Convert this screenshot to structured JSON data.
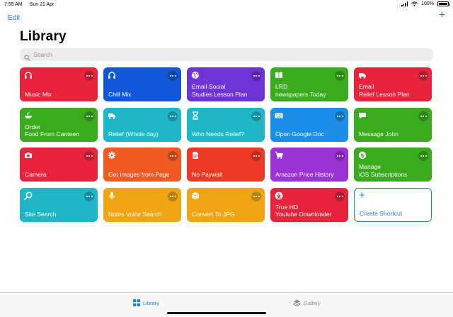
{
  "status": {
    "time": "7:55 AM",
    "date": "Sun 21 Apr",
    "battery": "100%",
    "battery_level": 1.0
  },
  "nav": {
    "edit_label": "Edit",
    "add_label": "+"
  },
  "title": "Library",
  "search": {
    "placeholder": "Search"
  },
  "shortcuts": [
    {
      "title": "Music Mix",
      "color": "#e8233c",
      "icon": "headphones-icon"
    },
    {
      "title": "Chill Mix",
      "color": "#1257d8",
      "icon": "headphones-icon"
    },
    {
      "title": "Email Social\nStudies Lesson Plan",
      "color": "#6d33d6",
      "icon": "globe-icon"
    },
    {
      "title": "LRD\nnewspapers Today",
      "color": "#3aaa1f",
      "icon": "book-icon"
    },
    {
      "title": "Email\nRelief Lesson Plan",
      "color": "#e8233c",
      "icon": "truck-icon"
    },
    {
      "title": "Order\nFood From Canteen",
      "color": "#3aaa1f",
      "icon": "food-icon"
    },
    {
      "title": "Relief (Whole day)",
      "color": "#1fb7c8",
      "icon": "truck-icon"
    },
    {
      "title": "Who Needs Relief?",
      "color": "#1fb7c8",
      "icon": "hourglass-icon"
    },
    {
      "title": "Open Google Doc",
      "color": "#1d8ee8",
      "icon": "keyboard-icon"
    },
    {
      "title": "Message John",
      "color": "#3aaa1f",
      "icon": "chat-icon"
    },
    {
      "title": "Camera",
      "color": "#e8233c",
      "icon": "camera-icon"
    },
    {
      "title": "Get Images from Page",
      "color": "#ee5a22",
      "icon": "gear-icon"
    },
    {
      "title": "No Paywall",
      "color": "#ec3a27",
      "icon": "document-icon"
    },
    {
      "title": "Amazon Price History",
      "color": "#9a32d4",
      "icon": "cart-icon"
    },
    {
      "title": "Manage\niOS Subscriptions",
      "color": "#3aaa1f",
      "icon": "dollar-icon"
    },
    {
      "title": "Site Search",
      "color": "#1fb7c8",
      "icon": "search-icon"
    },
    {
      "title": "Notes Voice Search",
      "color": "#f0a612",
      "icon": "microphone-icon"
    },
    {
      "title": "Convert To JPG",
      "color": "#f0a612",
      "icon": "cube-icon"
    },
    {
      "title": "True HD\nYoutube Downloader",
      "color": "#e8233c",
      "icon": "download-icon"
    }
  ],
  "create_shortcut": {
    "label": "Create Shortcut",
    "plus": "+"
  },
  "tabs": [
    {
      "label": "Library",
      "active": true,
      "icon": "grid-icon"
    },
    {
      "label": "Gallery",
      "active": false,
      "icon": "layers-icon"
    }
  ],
  "colors": {
    "accent": "#1a7ff5"
  }
}
